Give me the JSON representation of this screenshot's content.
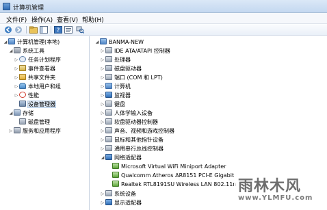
{
  "window": {
    "title": "计算机管理",
    "icon": "computer-management-icon"
  },
  "menu": [
    {
      "label": "文件(F)"
    },
    {
      "label": "操作(A)"
    },
    {
      "label": "查看(V)"
    },
    {
      "label": "帮助(H)"
    }
  ],
  "toolbar": {
    "buttons": [
      "back-arrow-icon",
      "forward-arrow-icon",
      "up-folder-icon",
      "show-hide-tree-icon",
      "help-icon",
      "properties-icon",
      "scan-hardware-icon"
    ]
  },
  "tree": {
    "root": "计算机管理(本地)",
    "system_tools": "系统工具",
    "task_scheduler": "任务计划程序",
    "event_viewer": "事件查看器",
    "shared_folders": "共享文件夹",
    "local_users": "本地用户和组",
    "performance": "性能",
    "device_manager": "设备管理器",
    "storage": "存储",
    "disk_management": "磁盘管理",
    "services": "服务和应用程序"
  },
  "devices": {
    "root": "BANMA-NEW",
    "categories": [
      {
        "label": "IDE ATA/ATAPI 控制器",
        "icon": "ide-controller-icon"
      },
      {
        "label": "处理器",
        "icon": "processor-icon"
      },
      {
        "label": "磁盘驱动器",
        "icon": "disk-drive-icon"
      },
      {
        "label": "端口 (COM 和 LPT)",
        "icon": "port-icon"
      },
      {
        "label": "计算机",
        "icon": "computer-icon"
      },
      {
        "label": "监视器",
        "icon": "monitor-icon"
      },
      {
        "label": "键盘",
        "icon": "keyboard-icon"
      },
      {
        "label": "人体学输入设备",
        "icon": "hid-icon"
      },
      {
        "label": "软盘驱动器控制器",
        "icon": "floppy-controller-icon"
      },
      {
        "label": "声音、视频和游戏控制器",
        "icon": "sound-icon"
      },
      {
        "label": "鼠标和其他指针设备",
        "icon": "mouse-icon"
      },
      {
        "label": "通用串行总线控制器",
        "icon": "usb-icon"
      }
    ],
    "network_adapters": {
      "label": "网络适配器",
      "children": [
        "Microsoft Virtual WiFi Miniport Adapter",
        "Qualcomm Atheros AR8151 PCI-E Gigabit",
        "Realtek RTL8191SU Wireless LAN 802.11n"
      ]
    },
    "after": [
      {
        "label": "系统设备",
        "icon": "system-devices-icon"
      },
      {
        "label": "显示适配器",
        "icon": "display-adapter-icon"
      }
    ]
  },
  "watermark": {
    "main": "雨林木风",
    "url": "www.YLMFU.com"
  }
}
